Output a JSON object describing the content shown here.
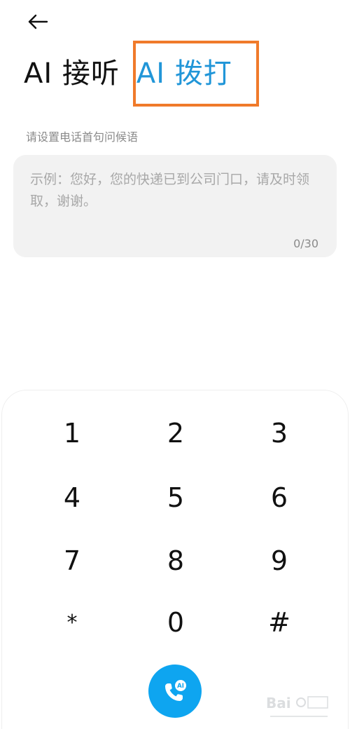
{
  "header": {
    "back_icon": "arrow-left-icon"
  },
  "tabs": [
    {
      "label": "AI 接听",
      "active": false
    },
    {
      "label": "AI 拨打",
      "active": true
    }
  ],
  "greeting": {
    "label": "请设置电话首句问候语",
    "placeholder": "示例：您好，您的快递已到公司门口，请及时领取，谢谢。",
    "counter": "0/30"
  },
  "dialpad": {
    "keys": [
      "1",
      "2",
      "3",
      "4",
      "5",
      "6",
      "7",
      "8",
      "9",
      "*",
      "0",
      "#"
    ],
    "call_button_icon": "ai-phone-icon",
    "call_badge": "AI"
  },
  "colors": {
    "accent": "#2196d8",
    "call_button": "#0ea5f0",
    "highlight": "#f07a2a"
  }
}
